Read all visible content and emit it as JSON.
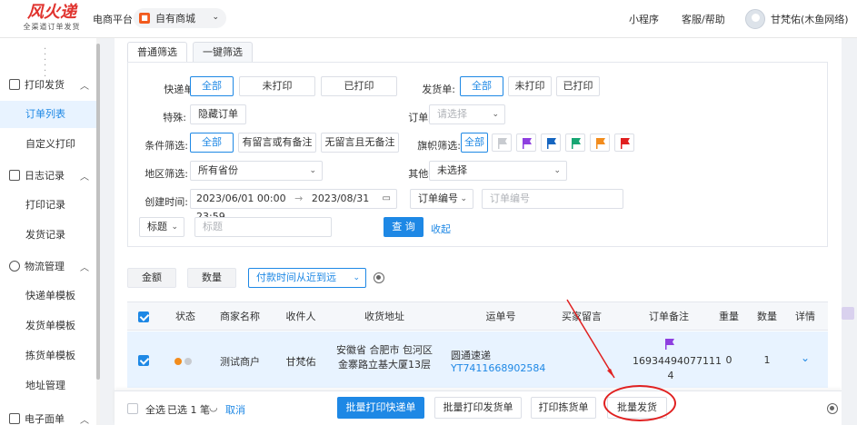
{
  "header": {
    "logo_main": "风火递",
    "logo_sub": "全渠道订单发货",
    "platform_label": "电商平台",
    "platform_value": "自有商城",
    "links": [
      "小程序",
      "客服/帮助"
    ],
    "user_name": "甘梵佑(木鱼网络)"
  },
  "sidebar": {
    "groups": [
      {
        "label": "打印发货",
        "items": [
          "订单列表",
          "自定义打印"
        ]
      },
      {
        "label": "日志记录",
        "items": [
          "打印记录",
          "发货记录"
        ]
      },
      {
        "label": "物流管理",
        "items": [
          "快递单模板",
          "发货单模板",
          "拣货单模板",
          "地址管理"
        ]
      },
      {
        "label": "电子面单",
        "items": []
      }
    ]
  },
  "tabs": [
    "普通筛选",
    "一键筛选"
  ],
  "filters": {
    "express_label": "快递单:",
    "express_options": [
      "全部",
      "未打印",
      "已打印"
    ],
    "ship_label": "发货单:",
    "ship_options": [
      "全部",
      "未打印",
      "已打印"
    ],
    "special_label": "特殊:",
    "special_option": "隐藏订单",
    "order_type_label": "订单类型:",
    "order_type_placeholder": "请选择",
    "condition_label": "条件筛选:",
    "condition_options": [
      "全部",
      "有留言或有备注",
      "无留言且无备注"
    ],
    "flag_label": "旗帜筛选:",
    "flag_all": "全部",
    "flag_colors": [
      "#c8cbd0",
      "#8e3fe0",
      "#1565c0",
      "#17a673",
      "#f28c1d",
      "#e02020"
    ],
    "region_label": "地区筛选:",
    "region_value": "所有省份",
    "other_label": "其他条件:",
    "other_value": "未选择",
    "created_label": "创建时间:",
    "date_start": "2023/06/01 00:00",
    "date_arrow": "→",
    "date_end": "2023/08/31 23:59",
    "order_no_select": "订单编号",
    "order_no_placeholder": "订单编号",
    "title_select": "标题",
    "title_placeholder": "标题",
    "query_btn": "查 询",
    "collapse_link": "收起"
  },
  "sortbar": {
    "amount": "金额",
    "quantity": "数量",
    "sort_value": "付款时间从近到远"
  },
  "table": {
    "columns": [
      "状态",
      "商家名称",
      "收件人",
      "收货地址",
      "运单号",
      "买家留言",
      "订单备注",
      "重量",
      "数量",
      "详情"
    ],
    "rows": [
      {
        "merchant": "测试商户",
        "recipient": "甘梵佑",
        "address_line1": "安徽省 合肥市 包河区",
        "address_line2": "金寨路立基大厦13层",
        "carrier": "圆通速递",
        "waybill": "YT7411668902584",
        "message": "",
        "remark_line1": "16934494077111",
        "remark_line2": "4",
        "weight": "0",
        "qty": "1"
      }
    ]
  },
  "footer": {
    "select_all": "全选",
    "selected_count": "已选 1 笔",
    "cancel": "取消",
    "btn_print_express": "批量打印快递单",
    "btn_print_ship": "批量打印发货单",
    "btn_print_pick": "打印拣货单",
    "btn_batch_ship": "批量发货"
  }
}
